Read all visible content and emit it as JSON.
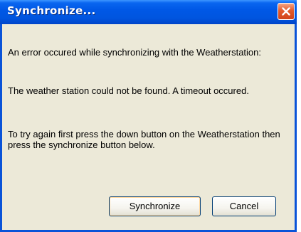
{
  "dialog": {
    "title": "Synchronize...",
    "close_icon": "close-icon",
    "messages": [
      "An error occured while synchronizing with the Weatherstation:",
      "The weather station could not be found. A timeout occured.",
      "To try again first press the down button on the Weatherstation then press the synchronize button below."
    ],
    "buttons": {
      "synchronize_label": "Synchronize",
      "cancel_label": "Cancel"
    }
  },
  "colors": {
    "titlebar": "#0058e6",
    "window_body": "#ece9d8",
    "close_button": "#e35a2b",
    "button_border": "#003c74"
  }
}
